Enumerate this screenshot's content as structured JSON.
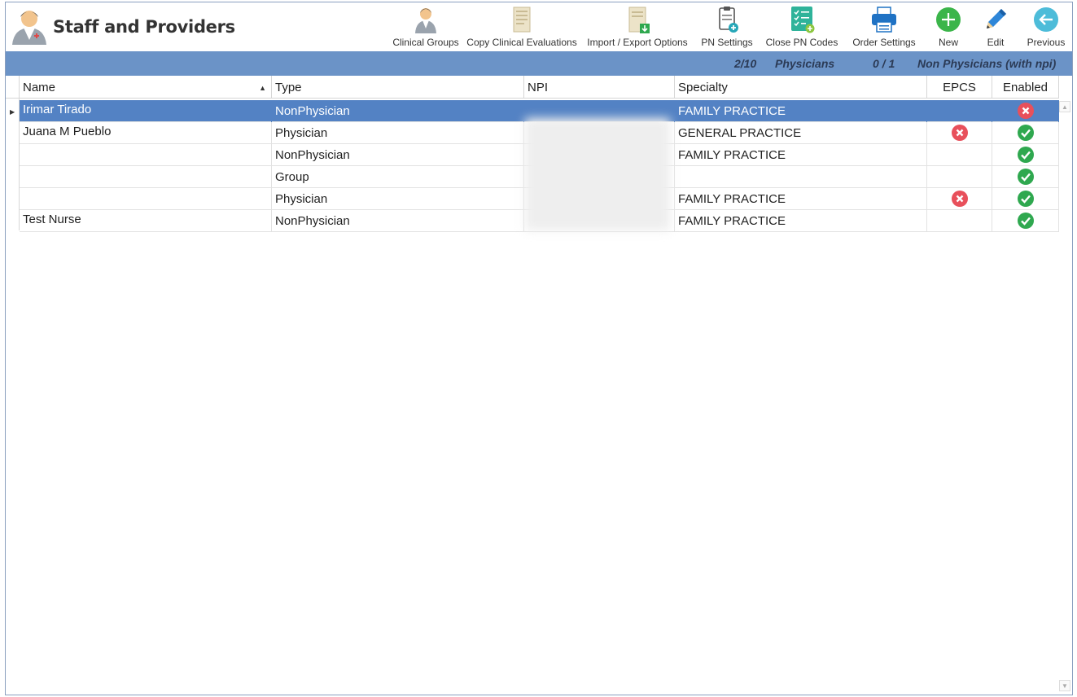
{
  "app": {
    "title": "Staff and Providers",
    "icon": "doctor-icon"
  },
  "toolbar": [
    {
      "id": "clinical-groups",
      "label": "Clinical Groups",
      "icon": "doctor-group-icon"
    },
    {
      "id": "copy-clinical-evaluations",
      "label": "Copy Clinical Evaluations",
      "icon": "document-copy-icon"
    },
    {
      "id": "import-export-options",
      "label": "Import / Export Options",
      "icon": "document-import-icon"
    },
    {
      "id": "pn-settings",
      "label": "PN Settings",
      "icon": "clipboard-add-icon"
    },
    {
      "id": "close-pn-codes",
      "label": "Close PN Codes",
      "icon": "checklist-add-icon"
    },
    {
      "id": "order-settings",
      "label": "Order Settings",
      "icon": "printer-icon"
    },
    {
      "id": "new",
      "label": "New",
      "icon": "plus-circle-icon"
    },
    {
      "id": "edit",
      "label": "Edit",
      "icon": "pencil-icon"
    },
    {
      "id": "previous",
      "label": "Previous",
      "icon": "arrow-left-circle-icon"
    }
  ],
  "summary": {
    "physicians_count": "2/10",
    "physicians_label": "Physicians",
    "non_physicians_count": "0 / 1",
    "non_physicians_label": "Non Physicians (with npi)"
  },
  "grid": {
    "columns": [
      {
        "key": "name",
        "label": "Name",
        "sorted": "ascending"
      },
      {
        "key": "type",
        "label": "Type"
      },
      {
        "key": "npi",
        "label": "NPI"
      },
      {
        "key": "specialty",
        "label": "Specialty"
      },
      {
        "key": "epcs",
        "label": "EPCS"
      },
      {
        "key": "enabled",
        "label": "Enabled"
      }
    ],
    "rows": [
      {
        "name": "Irimar Tirado",
        "type": "NonPhysician",
        "specialty": "FAMILY PRACTICE",
        "epcs": null,
        "enabled": false,
        "selected": true
      },
      {
        "name": "Juana M Pueblo",
        "type": "Physician",
        "specialty": "GENERAL PRACTICE",
        "epcs": false,
        "enabled": true
      },
      {
        "name": "",
        "type": "NonPhysician",
        "specialty": "FAMILY PRACTICE",
        "epcs": null,
        "enabled": true
      },
      {
        "name": "",
        "type": "Group",
        "specialty": "",
        "epcs": null,
        "enabled": true
      },
      {
        "name": "",
        "type": "Physician",
        "specialty": "FAMILY PRACTICE",
        "epcs": false,
        "enabled": true
      },
      {
        "name": "Test Nurse",
        "type": "NonPhysician",
        "specialty": "FAMILY PRACTICE",
        "epcs": null,
        "enabled": true
      }
    ]
  },
  "colors": {
    "selected_row": "#5382c4",
    "summary_bar": "#6b93c7",
    "status_yes": "#2fa84f",
    "status_no": "#e8505b"
  }
}
